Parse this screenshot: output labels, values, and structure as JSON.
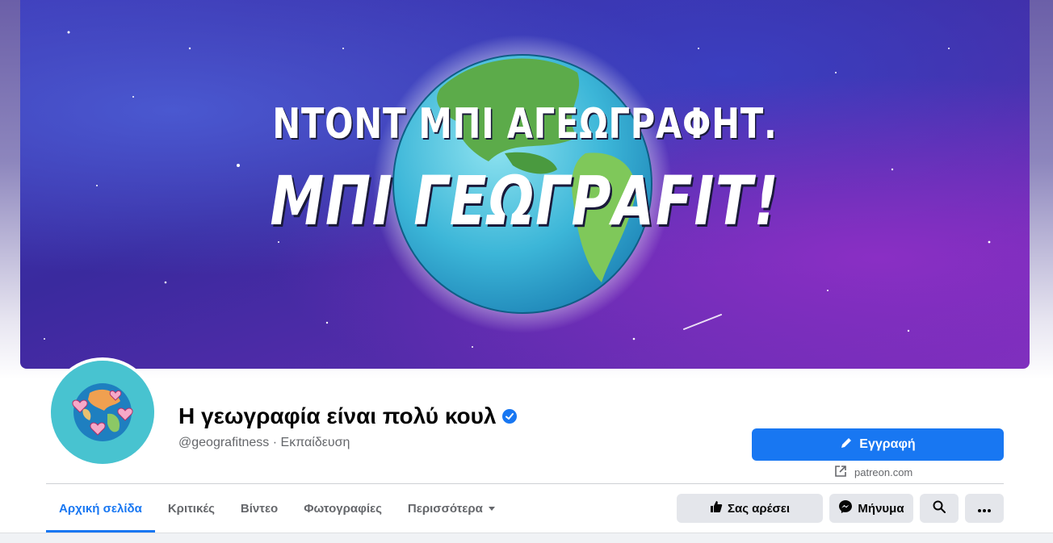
{
  "cover": {
    "line1": "ΝΤΟΝΤ ΜΠΙ ΑΓΕΩΓΡΑΦΗΤ.",
    "line2": "ΜΠΙ ΓΕΩΓΡAFIT!"
  },
  "profile": {
    "name": "Η γεωγραφία είναι πολύ κουλ",
    "verified_icon": "verified-badge-icon",
    "subtitle": "@geografitness · Εκπαίδευση"
  },
  "actions": {
    "signup_label": "Εγγραφή",
    "signup_icon": "pencil-icon",
    "link_text": "patreon.com",
    "link_icon": "external-link-icon",
    "like_label": "Σας αρέσει",
    "like_icon": "thumbs-up-icon",
    "message_label": "Μήνυμα",
    "message_icon": "messenger-icon",
    "search_icon": "search-icon",
    "more_icon": "ellipsis-icon"
  },
  "tabs": [
    {
      "label": "Αρχική σελίδα",
      "active": true
    },
    {
      "label": "Κριτικές"
    },
    {
      "label": "Βίντεο"
    },
    {
      "label": "Φωτογραφίες"
    },
    {
      "label": "Περισσότερα"
    }
  ],
  "colors": {
    "accent": "#1877f2",
    "button_gray": "#e4e6eb",
    "secondary_text": "#65676b"
  }
}
